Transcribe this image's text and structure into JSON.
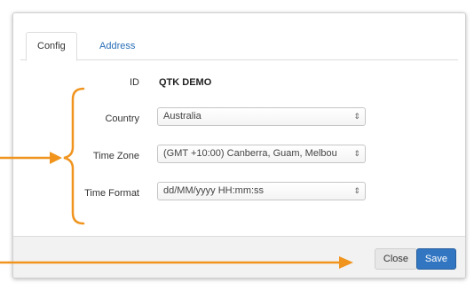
{
  "tabs": [
    {
      "label": "Config",
      "active": true
    },
    {
      "label": "Address",
      "active": false
    }
  ],
  "form": {
    "id_label": "ID",
    "id_value": "QTK DEMO",
    "country_label": "Country",
    "country_value": "Australia",
    "timezone_label": "Time Zone",
    "timezone_value": "(GMT +10:00) Canberra, Guam, Melbou",
    "timeformat_label": "Time Format",
    "timeformat_value": "dd/MM/yyyy HH:mm:ss"
  },
  "footer": {
    "close_label": "Close",
    "save_label": "Save"
  },
  "icons": {
    "select_caret": "up-down-caret-icon"
  },
  "colors": {
    "accent": "#3276c2",
    "link": "#2a6fb8",
    "annotation": "#f0941e"
  }
}
